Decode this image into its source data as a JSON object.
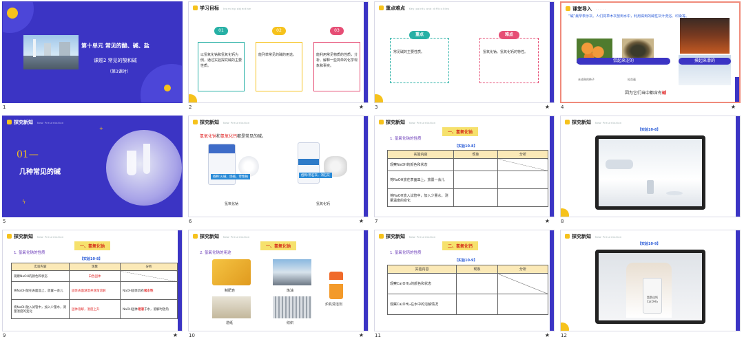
{
  "slides": [
    {
      "num": "1",
      "unit": "第十单元 常见的酸、碱、盐",
      "lesson": "课题2  常见的酸和碱",
      "period": "（第3课时）"
    },
    {
      "num": "2",
      "header": "学习目标",
      "header_sub": "learning objective",
      "goals": [
        {
          "n": "01",
          "text": "以氢氧化钠和氢氧化钙为例，通过实验探究碱的主要性质。"
        },
        {
          "n": "02",
          "text": "能列举常见的碱的用途。"
        },
        {
          "n": "03",
          "text": "能利用常见物质的性质，分析、解释一些简单的化学现象和事实。"
        }
      ]
    },
    {
      "num": "3",
      "header": "重点难点",
      "header_sub": "Key points and difficulties",
      "key_label": "重点",
      "key_text": "常见碱的主要性质。",
      "diff_label": "难点",
      "diff_text": "氢氧化钠、氢氧化钙的特性。"
    },
    {
      "num": "4",
      "header": "课堂导入",
      "intro": "“碱”最早表示灰。人们将草木灰放到水中，利用得到的碱性灰汁洗浴、印染等。",
      "banner1": "尝起来涩的",
      "banner2": "摸起来滑的",
      "cap1": "未成熟的柿子",
      "cap2": "松花蛋",
      "bottom": "因为它们当中都含有",
      "bottom_red": "碱"
    },
    {
      "num": "5",
      "header": "探究新知",
      "header_sub": "New Presentation",
      "sec_num": "01",
      "sec_title": "几种常见的碱"
    },
    {
      "num": "6",
      "header": "探究新知",
      "header_sub": "New Presentation",
      "line_a": "氢氧化钠",
      "line_b": "和",
      "line_c": "氢氧化钙",
      "line_d": "都是常见的碱。",
      "label1": "俗称:火碱、烧碱、苛性钠",
      "label2": "俗称:熟石灰、消石灰",
      "cap1": "氢氧化钠",
      "cap2": "氢氧化钙"
    },
    {
      "num": "7",
      "header": "探究新知",
      "header_sub": "New Presentation",
      "tag": "一、氢氧化钠",
      "sub": "1. 氢氧化钠的性质",
      "exp": "【实验10-8】",
      "cols": [
        "实验内容",
        "现象",
        "分析"
      ],
      "rows": [
        "观察NaOH的颜色和状态",
        "将NaOH放在表面皿上，放置一会儿",
        "将NaOH放入试管中，加入少量水，测量温度的变化"
      ]
    },
    {
      "num": "8",
      "header": "探究新知",
      "header_sub": "New Presentation",
      "exp": "【实验10-8】"
    },
    {
      "num": "9",
      "header": "探究新知",
      "header_sub": "New Presentation",
      "tag": "一、氢氧化钠",
      "sub": "1. 氢氧化钠的性质",
      "exp": "【实验10-8】",
      "cols": [
        "实验内容",
        "现象",
        "分析"
      ],
      "rows": [
        {
          "c": "观察NaOH的颜色和状态",
          "p": "白色固体",
          "a": ""
        },
        {
          "c": "将NaOH放在表面皿上，放置一会儿",
          "p": "固体表面潮湿并逐渐溶解",
          "a1": "NaOH固体具有",
          "a2": "吸水性"
        },
        {
          "c": "将NaOH放入试管中，加入少量水，测量温度的变化",
          "p": "固体溶解，温度上升",
          "a1": "NaOH固体",
          "a2": "易溶",
          "a3": "于水，溶解时放热"
        }
      ]
    },
    {
      "num": "10",
      "header": "探究新知",
      "header_sub": "New Presentation",
      "tag": "一、氢氧化钠",
      "sub": "2. 氢氧化钠的用途",
      "uses": [
        "制肥皂",
        "炼油",
        "造纸",
        "纺织",
        "炉具清洁剂"
      ]
    },
    {
      "num": "11",
      "header": "探究新知",
      "header_sub": "New Presentation",
      "tag": "二、氢氧化钙",
      "sub": "1. 氢氧化钙的性质",
      "exp": "【实验10-9】",
      "cols": [
        "实验内容",
        "现象",
        "分析"
      ],
      "rows": [
        "观察Ca(OH)₂的颜色和状态",
        "观察Ca(OH)₂在水中的溶解情况"
      ]
    },
    {
      "num": "12",
      "header": "探究新知",
      "header_sub": "New Presentation",
      "exp": "【实验10-9】",
      "bottle": "氢氧化钙 Ca(OH)₂"
    }
  ],
  "colors": {
    "purple": "#3b34c4",
    "yellow": "#f6c21c",
    "red": "#e12b2b",
    "blue": "#2a5bd7",
    "selected_border": "#f08a7a"
  }
}
